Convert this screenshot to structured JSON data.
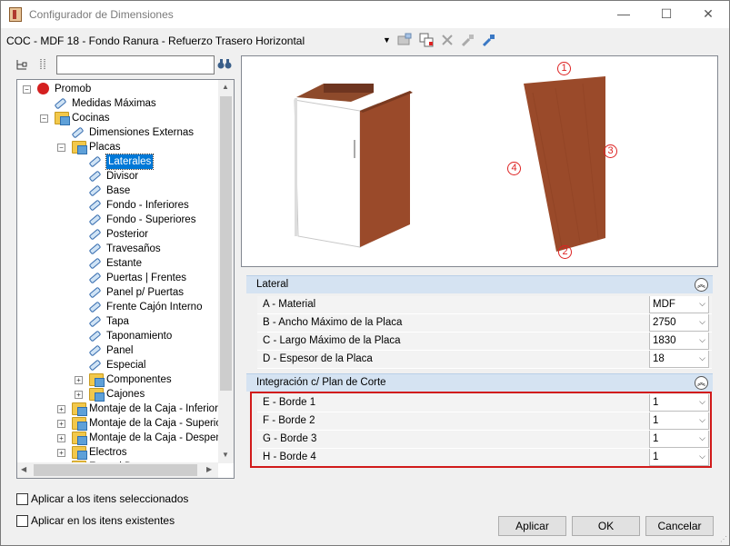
{
  "window": {
    "title": "Configurador de Dimensiones",
    "minimize": "—",
    "maximize": "☐",
    "close": "✕"
  },
  "toolbar": {
    "config_name": "COC - MDF 18 - Fondo Ranura - Refuerzo Trasero Horizontal"
  },
  "tree": {
    "items": [
      {
        "label": "Promob",
        "level": 0,
        "expander": "−",
        "icon": "promob-icon"
      },
      {
        "label": "Medidas Máximas",
        "level": 1,
        "expander": "",
        "icon": "tag-icon"
      },
      {
        "label": "Cocinas",
        "level": 1,
        "expander": "−",
        "icon": "folder-icon"
      },
      {
        "label": "Dimensiones Externas",
        "level": 2,
        "expander": "",
        "icon": "tag-icon"
      },
      {
        "label": "Placas",
        "level": 2,
        "expander": "−",
        "icon": "folder-icon"
      },
      {
        "label": "Laterales",
        "level": 3,
        "expander": "",
        "icon": "tag-icon",
        "selected": true
      },
      {
        "label": "Divisor",
        "level": 3,
        "expander": "",
        "icon": "tag-icon"
      },
      {
        "label": "Base",
        "level": 3,
        "expander": "",
        "icon": "tag-icon"
      },
      {
        "label": "Fondo - Inferiores",
        "level": 3,
        "expander": "",
        "icon": "tag-icon"
      },
      {
        "label": "Fondo - Superiores",
        "level": 3,
        "expander": "",
        "icon": "tag-icon"
      },
      {
        "label": "Posterior",
        "level": 3,
        "expander": "",
        "icon": "tag-icon"
      },
      {
        "label": "Travesaños",
        "level": 3,
        "expander": "",
        "icon": "tag-icon"
      },
      {
        "label": "Estante",
        "level": 3,
        "expander": "",
        "icon": "tag-icon"
      },
      {
        "label": "Puertas | Frentes",
        "level": 3,
        "expander": "",
        "icon": "tag-icon"
      },
      {
        "label": "Panel p/ Puertas",
        "level": 3,
        "expander": "",
        "icon": "tag-icon"
      },
      {
        "label": "Frente Cajón Interno",
        "level": 3,
        "expander": "",
        "icon": "tag-icon"
      },
      {
        "label": "Tapa",
        "level": 3,
        "expander": "",
        "icon": "tag-icon"
      },
      {
        "label": "Taponamiento",
        "level": 3,
        "expander": "",
        "icon": "tag-icon"
      },
      {
        "label": "Panel",
        "level": 3,
        "expander": "",
        "icon": "tag-icon"
      },
      {
        "label": "Especial",
        "level": 3,
        "expander": "",
        "icon": "tag-icon"
      },
      {
        "label": "Componentes",
        "level": 3,
        "expander": "+",
        "icon": "folder-icon"
      },
      {
        "label": "Cajones",
        "level": 3,
        "expander": "+",
        "icon": "folder-icon"
      },
      {
        "label": "Montaje de la Caja - Inferior",
        "level": 2,
        "expander": "+",
        "icon": "folder-icon"
      },
      {
        "label": "Montaje de la Caja - Superior",
        "level": 2,
        "expander": "+",
        "icon": "folder-icon"
      },
      {
        "label": "Montaje de la Caja - Despensa",
        "level": 2,
        "expander": "+",
        "icon": "folder-icon"
      },
      {
        "label": "Electros",
        "level": 2,
        "expander": "+",
        "icon": "folder-icon"
      },
      {
        "label": "Frontal Desta...",
        "level": 2,
        "expander": "+",
        "icon": "folder-icon"
      }
    ]
  },
  "preview": {
    "edge_labels": [
      "1",
      "2",
      "3",
      "4"
    ]
  },
  "sections": [
    {
      "title": "Lateral",
      "rows": [
        {
          "label": "A - Material",
          "value": "MDF"
        },
        {
          "label": "B -  Ancho Máximo de la Placa",
          "value": "2750"
        },
        {
          "label": "C - Largo Máximo de la Placa",
          "value": "1830"
        },
        {
          "label": "D - Espesor de la Placa",
          "value": "18"
        }
      ]
    },
    {
      "title": "Integración c/ Plan de Corte",
      "rows": [
        {
          "label": "E - Borde 1",
          "value": "1"
        },
        {
          "label": "F - Borde 2",
          "value": "1"
        },
        {
          "label": "G - Borde 3",
          "value": "1"
        },
        {
          "label": "H - Borde 4",
          "value": "1"
        }
      ]
    }
  ],
  "options": {
    "apply_selected": "Aplicar a los itens seleccionados",
    "apply_existing": "Aplicar en los itens existentes"
  },
  "buttons": {
    "apply": "Aplicar",
    "ok": "OK",
    "cancel": "Cancelar"
  },
  "colors": {
    "highlight": "#d11a1a",
    "section_bg": "#d5e3f2",
    "selection": "#0078d7",
    "wood": "#9a4a2a"
  }
}
